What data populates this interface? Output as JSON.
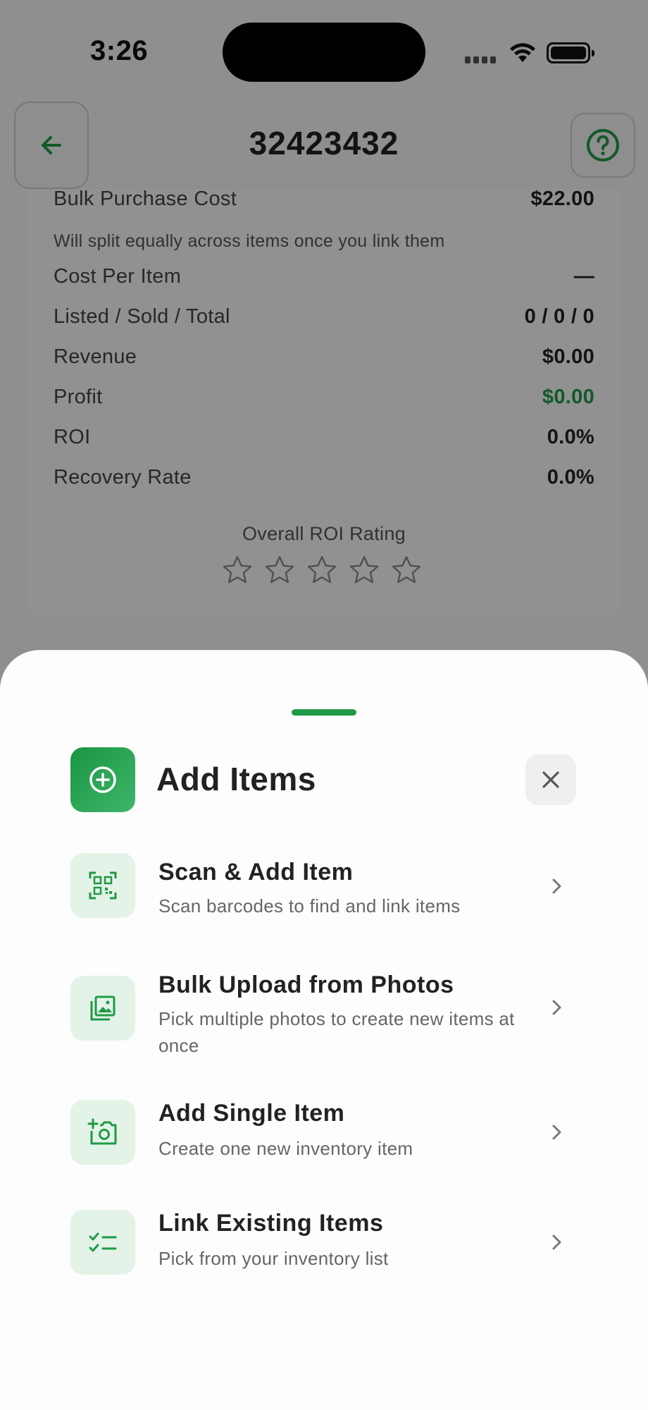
{
  "status_bar": {
    "time": "3:26"
  },
  "header": {
    "title": "32423432",
    "back_icon": "arrow-left-icon",
    "help_icon": "question-circle-icon"
  },
  "summary": {
    "bulk_cost_label": "Bulk Purchase Cost",
    "bulk_cost_value": "$22.00",
    "split_note": "Will split equally across items once you link them",
    "rows": [
      {
        "label": "Cost Per Item",
        "value": "—"
      },
      {
        "label": "Listed / Sold / Total",
        "value": "0 / 0 / 0"
      },
      {
        "label": "Revenue",
        "value": "$0.00"
      },
      {
        "label": "Profit",
        "value": "$0.00"
      },
      {
        "label": "ROI",
        "value": "0.0%"
      },
      {
        "label": "Recovery Rate",
        "value": "0.0%"
      }
    ],
    "roi_rating_label": "Overall ROI Rating",
    "roi_rating_stars": 0,
    "roi_rating_max": 5
  },
  "sheet": {
    "title": "Add Items",
    "title_icon": "plus-circle-icon",
    "close_icon": "close-icon",
    "accent_color": "#1f9a45",
    "options": [
      {
        "title": "Scan & Add Item",
        "subtitle": "Scan barcodes to find and link items",
        "icon": "qr-scan-icon"
      },
      {
        "title": "Bulk Upload from Photos",
        "subtitle": "Pick multiple photos to create new items at once",
        "icon": "photo-library-icon"
      },
      {
        "title": "Add Single Item",
        "subtitle": "Create one new inventory item",
        "icon": "add-camera-icon"
      },
      {
        "title": "Link Existing Items",
        "subtitle": "Pick from your inventory list",
        "icon": "checklist-icon"
      }
    ]
  }
}
